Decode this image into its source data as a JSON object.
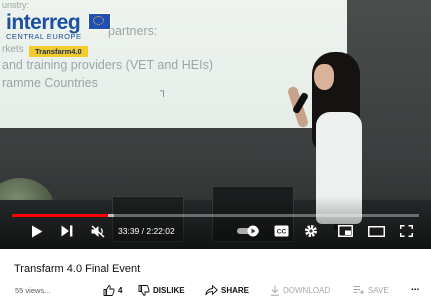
{
  "slide": {
    "logo_word": "interreg",
    "logo_sub": "CENTRAL EUROPE",
    "logo_badge": "Transfarm4.0",
    "lines": [
      "unstry:",
      "partners:",
      "rkets",
      "and training providers (VET and HEIs)",
      "ramme Countries"
    ]
  },
  "player": {
    "time_display": "33:39 / 2:22:02",
    "progress_fraction": 0.2366,
    "buffer_fraction": 0.25,
    "icons": [
      "play-icon",
      "next-icon",
      "mute-icon",
      "autoplay-toggle-icon",
      "captions-icon",
      "settings-icon",
      "miniplayer-icon",
      "theater-icon",
      "fullscreen-icon"
    ]
  },
  "video": {
    "title": "Transfarm 4.0 Final Event",
    "views": "55 views..."
  },
  "actions": {
    "like_count": "4",
    "dislike_label": "DISLIKE",
    "share_label": "SHARE",
    "download_label": "DOWNLOAD",
    "save_label": "SAVE",
    "more_label": "..."
  },
  "colors": {
    "progress": "#ff0000",
    "logo_blue": "#1c4fa0",
    "badge_yellow": "#f2cc2c"
  }
}
